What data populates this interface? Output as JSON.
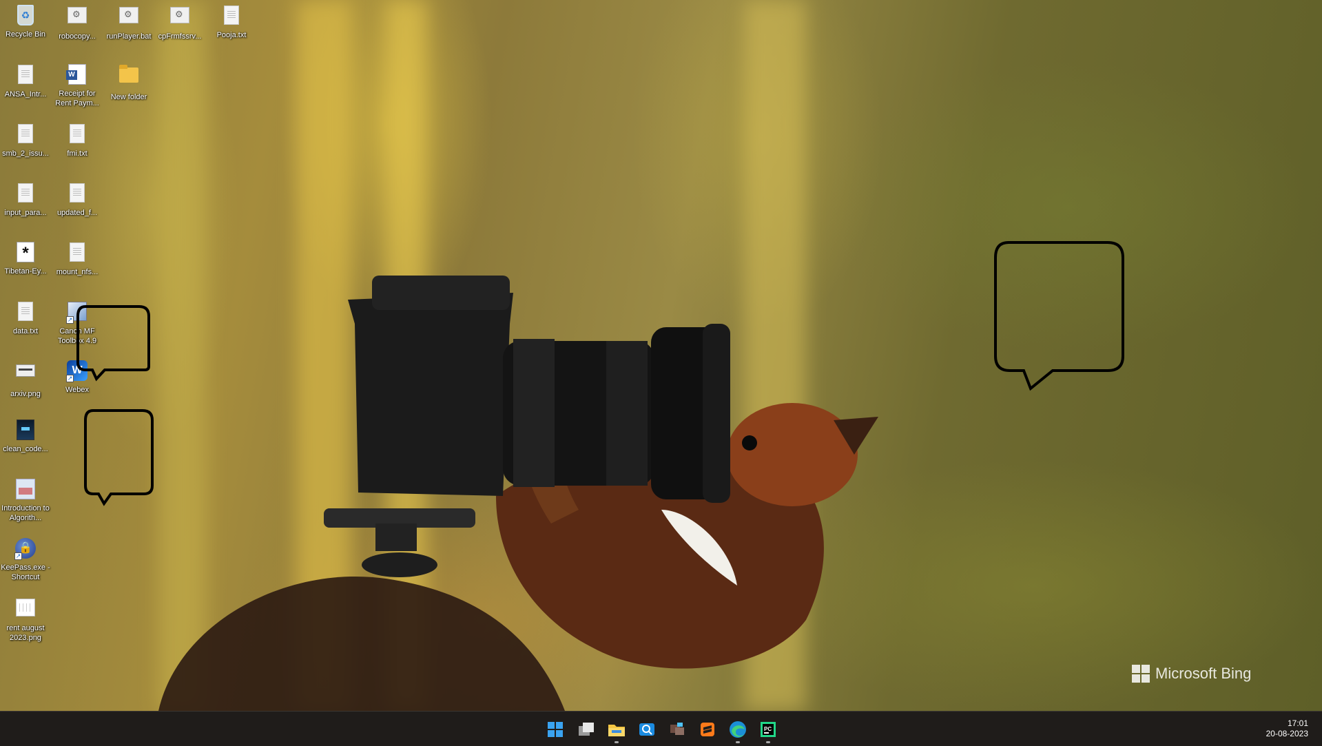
{
  "desktop": {
    "icons": [
      {
        "label": "Recycle Bin",
        "icon": "recycle-bin-icon"
      },
      {
        "label": "robocopy...",
        "icon": "batch-file-icon"
      },
      {
        "label": "runPlayer.bat",
        "icon": "batch-file-icon"
      },
      {
        "label": "cpFrmfssrv...",
        "icon": "batch-file-icon"
      },
      {
        "label": "Pooja.txt",
        "icon": "text-file-icon"
      },
      {
        "label": "ANSA_Intr...",
        "icon": "text-file-icon"
      },
      {
        "label": "Receipt for Rent Paym...",
        "icon": "word-document-icon"
      },
      {
        "label": "New folder",
        "icon": "folder-icon"
      },
      {
        "label": "smb_2_issu...",
        "icon": "text-file-icon"
      },
      {
        "label": "fmi.txt",
        "icon": "text-file-icon"
      },
      {
        "label": "input_para...",
        "icon": "text-file-icon"
      },
      {
        "label": "updated_f...",
        "icon": "text-file-icon"
      },
      {
        "label": "Tibetan-Ey...",
        "icon": "asterisk-file-icon"
      },
      {
        "label": "mount_nfs...",
        "icon": "text-file-icon"
      },
      {
        "label": "data.txt",
        "icon": "text-file-icon"
      },
      {
        "label": "Canon MF Toolbox 4.9",
        "icon": "canon-toolbox-icon"
      },
      {
        "label": "arxiv.png",
        "icon": "image-file-icon"
      },
      {
        "label": "Webex",
        "icon": "webex-icon"
      },
      {
        "label": "clean_code...",
        "icon": "pdf-book-icon"
      },
      {
        "label": "Introduction to Algorith...",
        "icon": "pdf-book-icon"
      },
      {
        "label": "KeePass.exe - Shortcut",
        "icon": "keepass-icon"
      },
      {
        "label": "rent august 2023.png",
        "icon": "image-file-icon"
      }
    ]
  },
  "wallpaper": {
    "watermark": "Microsoft Bing"
  },
  "taskbar": {
    "apps": [
      {
        "name": "Start",
        "icon": "windows-start-icon"
      },
      {
        "name": "Task View",
        "icon": "task-view-icon"
      },
      {
        "name": "File Explorer",
        "icon": "file-explorer-icon"
      },
      {
        "name": "Search",
        "icon": "search-icon"
      },
      {
        "name": "Remote Desktop",
        "icon": "remote-desktop-icon"
      },
      {
        "name": "Sublime Merge",
        "icon": "git-client-icon"
      },
      {
        "name": "Microsoft Edge",
        "icon": "edge-browser-icon"
      },
      {
        "name": "PyCharm",
        "icon": "pycharm-icon"
      }
    ],
    "clock": {
      "time": "17:01",
      "date": "20-08-2023"
    }
  },
  "colors": {
    "taskbar_bg": "#1f1c1a",
    "accent": "#3aa3f0"
  }
}
